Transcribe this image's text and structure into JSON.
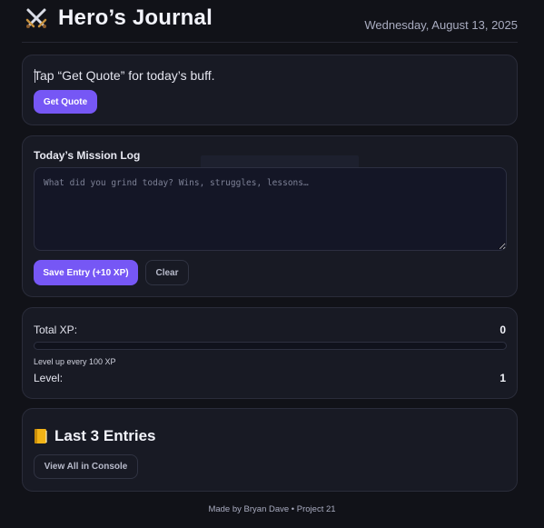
{
  "header": {
    "icon": "crossed-swords-icon",
    "title": "Hero’s Journal",
    "date": "Wednesday, August 13, 2025"
  },
  "quote": {
    "text": "Tap “Get Quote” for today’s buff.",
    "button_label": "Get Quote"
  },
  "mission": {
    "label": "Today’s Mission Log",
    "placeholder": "What did you grind today? Wins, struggles, lessons…",
    "value": "",
    "save_label": "Save Entry (+10 XP)",
    "clear_label": "Clear"
  },
  "xp": {
    "total_label": "Total XP:",
    "total_value": "0",
    "progress_fraction": 0,
    "note": "Level up every 100 XP",
    "level_label": "Level:",
    "level_value": "1"
  },
  "entries": {
    "icon": "book-icon",
    "title": "Last 3 Entries",
    "button_label": "View All in Console"
  },
  "footer": {
    "text": "Made by Bryan Dave • Project 21"
  },
  "colors": {
    "background": "#111218",
    "card": "#181a24",
    "accent": "#7657f5",
    "border": "#2a2c3a"
  }
}
